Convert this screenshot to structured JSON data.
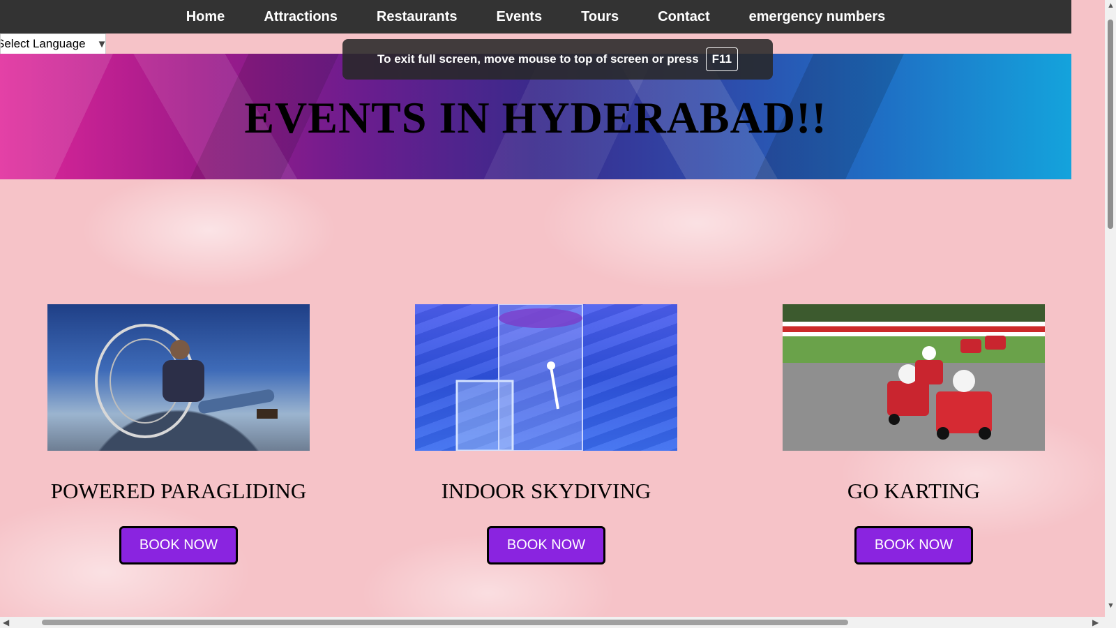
{
  "nav": {
    "items": [
      {
        "label": "Home"
      },
      {
        "label": "Attractions"
      },
      {
        "label": "Restaurants"
      },
      {
        "label": "Events"
      },
      {
        "label": "Tours"
      },
      {
        "label": "Contact"
      },
      {
        "label": "emergency numbers"
      }
    ]
  },
  "language": {
    "label": "Select Language",
    "arrow_icon": "triangle-down-icon"
  },
  "fullscreen_notice": {
    "text": "To exit full screen, move mouse to top of screen or press",
    "key": "F11"
  },
  "banner": {
    "title": "EVENTS IN HYDERABAD!!"
  },
  "events": [
    {
      "title": "POWERED PARAGLIDING",
      "button": "BOOK NOW",
      "image": "paragliding-photo"
    },
    {
      "title": "INDOOR SKYDIVING",
      "button": "BOOK NOW",
      "image": "skydiving-photo"
    },
    {
      "title": "GO KARTING",
      "button": "BOOK NOW",
      "image": "karting-photo"
    }
  ],
  "colors": {
    "navbar": "#333333",
    "button": "#8a24e0",
    "page_background": "#f6c3c8"
  }
}
